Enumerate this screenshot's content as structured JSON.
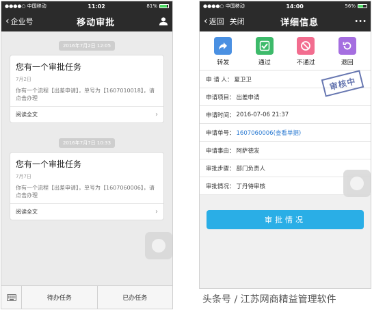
{
  "left": {
    "status": {
      "carrier": "●●●●○ 中国移动 ",
      "time": "11:02",
      "battery": "81%",
      "battery_level": 0.81
    },
    "nav": {
      "back": "企业号",
      "title": "移动审批"
    },
    "messages": [
      {
        "timestamp": "2016年7月2日 12:05",
        "title": "您有一个审批任务",
        "date": "7月2日",
        "desc": "你有一个流程【出差申请】，单号为【1607010018】，请点击办理",
        "read": "阅读全文"
      },
      {
        "timestamp": "2016年7月7日 10:33",
        "title": "您有一个审批任务",
        "date": "7月7日",
        "desc": "你有一个流程【出差申请】，单号为【1607060006】，请点击办理",
        "read": "阅读全文"
      }
    ],
    "tabs": {
      "pending": "待办任务",
      "done": "已办任务"
    }
  },
  "right": {
    "status": {
      "carrier": "●●●●○ 中国移动 ",
      "time": "14:00",
      "battery": "56%",
      "battery_level": 0.56
    },
    "nav": {
      "back": "返回",
      "close": "关闭",
      "title": "详细信息",
      "more": "•••"
    },
    "actions": [
      {
        "label": "转发",
        "icon": "forward-icon",
        "color": "#4a90e2"
      },
      {
        "label": "通过",
        "icon": "check-icon",
        "color": "#3dba6a"
      },
      {
        "label": "不通过",
        "icon": "reject-icon",
        "color": "#f26d8f"
      },
      {
        "label": "退回",
        "icon": "return-icon",
        "color": "#a56ee0"
      }
    ],
    "fields": [
      {
        "key": "申 请 人：",
        "value": "夏卫卫"
      },
      {
        "key": "申请项目：",
        "value": "出差申请"
      },
      {
        "key": "申请时间：",
        "value": "2016-07-06 21:37"
      },
      {
        "key": "申请单号：",
        "value": "1607060006(查看单据)"
      },
      {
        "key": "申请事由：",
        "value": "阿萨德发"
      },
      {
        "key": "审批步骤：",
        "value": "部门负责人"
      },
      {
        "key": "审批情况：",
        "value": "丁丹待审核"
      }
    ],
    "stamp": "审核中",
    "button": "审批情况"
  },
  "watermark": "头条号 / 江苏网商精益管理软件"
}
